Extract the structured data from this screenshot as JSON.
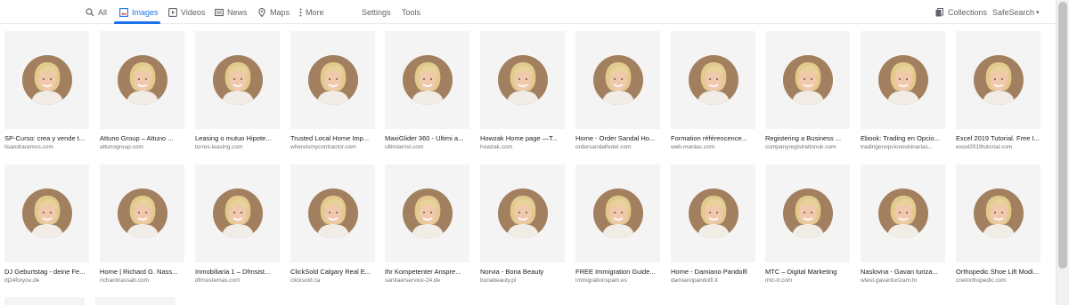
{
  "nav": {
    "tabs": [
      {
        "label": "All",
        "icon": "search-icon"
      },
      {
        "label": "Images",
        "icon": "image-icon",
        "active": true
      },
      {
        "label": "Videos",
        "icon": "play-icon"
      },
      {
        "label": "News",
        "icon": "newspaper-icon"
      },
      {
        "label": "Maps",
        "icon": "map-pin-icon"
      },
      {
        "label": "More",
        "icon": "more-vert-icon"
      }
    ],
    "settings": "Settings",
    "tools": "Tools",
    "collections": "Collections",
    "safesearch": "SafeSearch"
  },
  "colors": {
    "accent": "#1a73e8",
    "text": "#5f6368"
  },
  "results": [
    {
      "title": "SP-Curso: crea y vende t...",
      "domain": "lisandraramos.com"
    },
    {
      "title": "Attuno Group – Attuno ...",
      "domain": "attunogroup.com"
    },
    {
      "title": "Leasing o mutuo Hipote...",
      "domain": "torres-leasing.com"
    },
    {
      "title": "Trusted Local Home Imp...",
      "domain": "whereismycontractor.com"
    },
    {
      "title": "MaxiGlider 360 - Ultimi a...",
      "domain": "ultimiarrivi.com"
    },
    {
      "title": "Howzak Home page —T...",
      "domain": "howzak.com"
    },
    {
      "title": "Home - Order Sandal Ho...",
      "domain": "ordersandalhotel.com"
    },
    {
      "title": "Formation référencence...",
      "domain": "web-maniac.com"
    },
    {
      "title": "Registering a Business ...",
      "domain": "companyregistrationuk.com"
    },
    {
      "title": "Ebook: Trading en Opcio...",
      "domain": "tradingenopcionesbinarias..."
    },
    {
      "title": "Excel 2019 Tutorial. Free I...",
      "domain": "excel2019tutorial.com"
    },
    {
      "title": "DJ Geburtstag - deine Fe...",
      "domain": "dj24foryou.de"
    },
    {
      "title": "Home | Richard G. Nass...",
      "domain": "richardnassab.com"
    },
    {
      "title": "Inmobiliaria 1 – Dfmsist...",
      "domain": "dfmsistemas.com"
    },
    {
      "title": "ClickSold Calgary Real E...",
      "domain": "clicksold.ca"
    },
    {
      "title": "Ihr Kompetenter Anspre...",
      "domain": "sanitaerservice-24.de"
    },
    {
      "title": "Norvia - Bona Beauty",
      "domain": "bonabeauty.pl"
    },
    {
      "title": "FREE Immigration Guide...",
      "domain": "immigrationspain.es"
    },
    {
      "title": "Home - Damiano Pandolfi",
      "domain": "damianopandolfi.it"
    },
    {
      "title": "MTC – Digital Marketing",
      "domain": "mtc-tr.com"
    },
    {
      "title": "Naslovna - Gavan turiza...",
      "domain": "wtest.gavanturizam.hr"
    },
    {
      "title": "Orthopedic Shoe Lift Modi...",
      "domain": "cnetorthopedic.com"
    }
  ]
}
